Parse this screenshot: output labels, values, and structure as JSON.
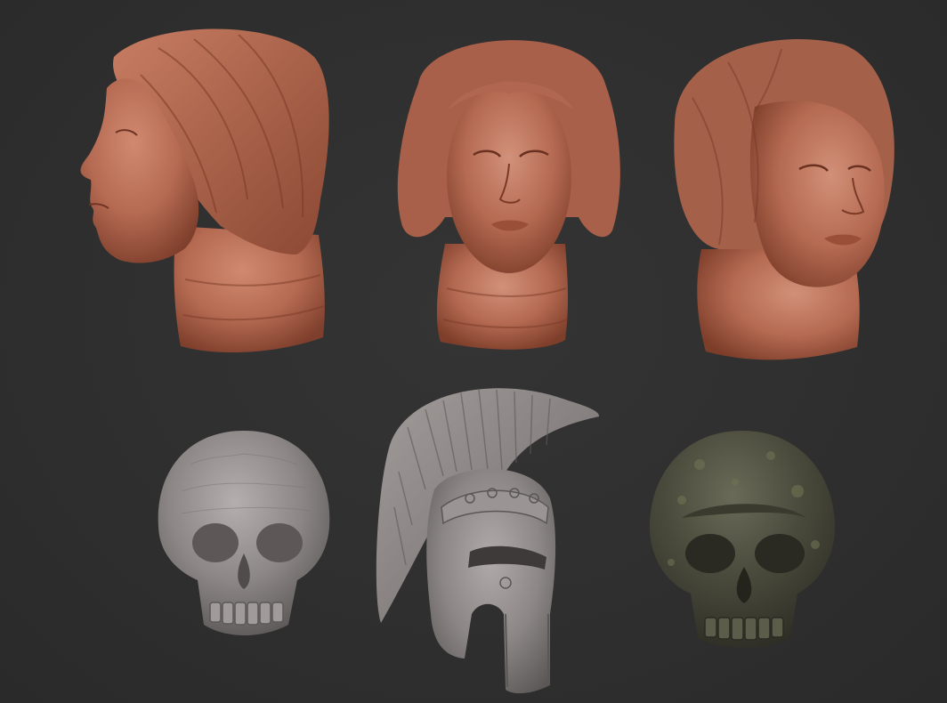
{
  "scene": {
    "background_color": "#2e2e2e",
    "models": [
      {
        "name": "female-head-side-view",
        "material": "clay-red",
        "color": "#b56a52"
      },
      {
        "name": "female-head-front-view",
        "material": "clay-red",
        "color": "#b56a52"
      },
      {
        "name": "female-head-three-quarter-view",
        "material": "clay-red",
        "color": "#b56a52"
      },
      {
        "name": "skull-sculpt",
        "material": "grey-clay",
        "color": "#8a8686"
      },
      {
        "name": "corinthian-helmet-sculpt",
        "material": "grey-clay",
        "color": "#8c8786"
      },
      {
        "name": "stone-skull-sculpt",
        "material": "mossy-stone",
        "color": "#4a4a3c"
      }
    ]
  }
}
